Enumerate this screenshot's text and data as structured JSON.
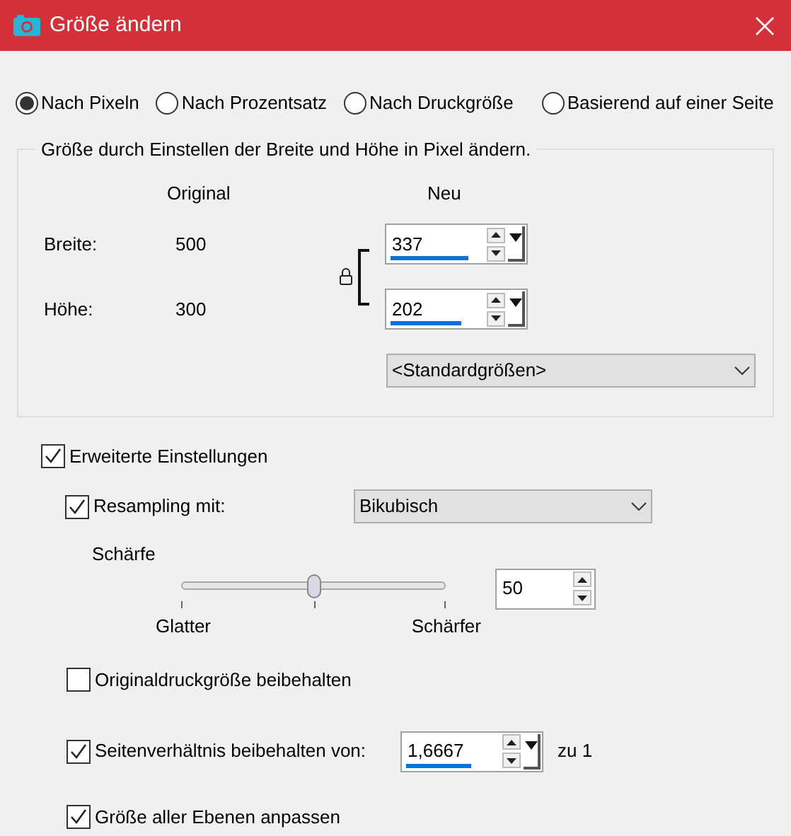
{
  "window": {
    "title": "Größe ändern"
  },
  "modes": [
    {
      "label": "Nach Pixeln",
      "selected": true
    },
    {
      "label": "Nach Prozentsatz",
      "selected": false
    },
    {
      "label": "Nach Druckgröße",
      "selected": false
    },
    {
      "label": "Basierend auf einer Seite",
      "selected": false
    }
  ],
  "pixel_group": {
    "legend": "Größe durch Einstellen der Breite und Höhe in Pixel ändern.",
    "original_header": "Original",
    "new_header": "Neu",
    "rows": [
      {
        "label": "Breite:",
        "original": "500",
        "value": "337",
        "level": 0.6
      },
      {
        "label": "Höhe:",
        "original": "300",
        "value": "202",
        "level": 0.55
      }
    ],
    "linked": true,
    "preset": "<Standardgrößen>"
  },
  "advanced": {
    "label": "Erweiterte Einstellungen",
    "checked": true
  },
  "resampling": {
    "label": "Resampling mit:",
    "checked": true,
    "method": "Bikubisch"
  },
  "sharpness": {
    "label": "Schärfe",
    "level": 0.5,
    "min_label": "Glatter",
    "max_label": "Schärfer",
    "value": "50"
  },
  "keep_print_size": {
    "label": "Originaldruckgröße beibehalten",
    "checked": false
  },
  "aspect": {
    "label": "Seitenverhältnis beibehalten von:",
    "checked": true,
    "value": "1,6667",
    "level": 0.5,
    "suffix": "zu 1"
  },
  "all_layers": {
    "label": "Größe aller Ebenen anpassen",
    "checked": true
  }
}
